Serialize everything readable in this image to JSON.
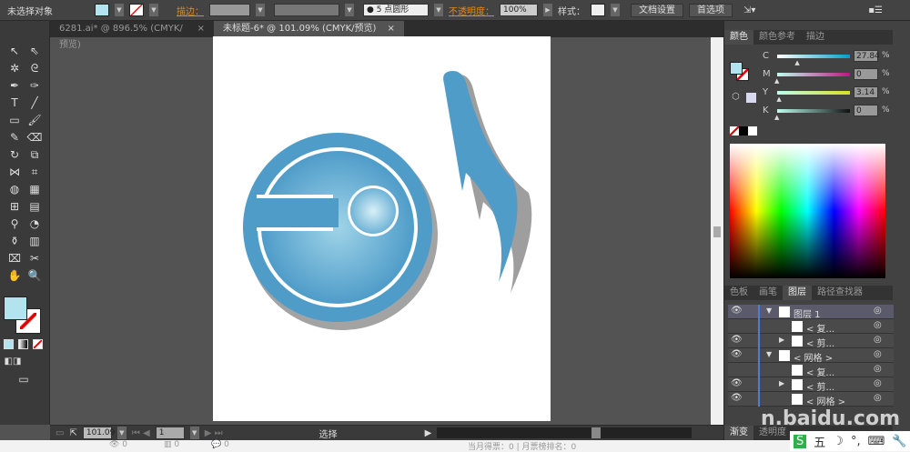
{
  "control_bar": {
    "selection": "未选择对象",
    "stroke_label": "描边：",
    "brush": "5 点圆形",
    "opacity_label": "不透明度：",
    "opacity_value": "100%",
    "style_label": "样式：",
    "doc_setup": "文档设置",
    "preferences": "首选项"
  },
  "tabs": [
    {
      "label": "6281.ai* @ 896.5% (CMYK/预览)",
      "close": "×"
    },
    {
      "label": "未标题-6* @ 101.09% (CMYK/预览)",
      "close": "×"
    }
  ],
  "status": {
    "zoom": "101.09",
    "page": "1",
    "tool": "选择"
  },
  "below": {
    "a": "0",
    "b": "0",
    "c": "0",
    "right": "当月得票：0 | 月票榜排名：0"
  },
  "color_panel": {
    "tabs": [
      "颜色",
      "颜色参考",
      "描边"
    ],
    "channels": [
      {
        "name": "C",
        "value": "27.84",
        "pct": "%",
        "pos": 0.28,
        "grad": "linear-gradient(90deg,#fff,#00a0c6)"
      },
      {
        "name": "M",
        "value": "0",
        "pct": "%",
        "pos": 0,
        "grad": "linear-gradient(90deg,#bfe,#c0157f)"
      },
      {
        "name": "Y",
        "value": "3.14",
        "pct": "%",
        "pos": 0.03,
        "grad": "linear-gradient(90deg,#bfe,#d9e021)"
      },
      {
        "name": "K",
        "value": "0",
        "pct": "%",
        "pos": 0,
        "grad": "linear-gradient(90deg,#bfe,#111)"
      }
    ]
  },
  "layers_panel": {
    "tabs": [
      "色板",
      "画笔",
      "图层",
      "路径查找器"
    ],
    "rows": [
      {
        "label": "图层 1",
        "eye": true,
        "exp": "▼"
      },
      {
        "label": "< 复...",
        "eye": false,
        "exp": ""
      },
      {
        "label": "< 剪...",
        "eye": true,
        "exp": "▶"
      },
      {
        "label": "< 网格 >",
        "eye": true,
        "exp": "▼"
      },
      {
        "label": "< 复...",
        "eye": false,
        "exp": ""
      },
      {
        "label": "< 剪...",
        "eye": true,
        "exp": "▶"
      },
      {
        "label": "< 网格 >",
        "eye": true,
        "exp": ""
      }
    ],
    "bottom_tabs": [
      "渐变",
      "透明度"
    ]
  },
  "watermark": "n.baidu.com",
  "ime": "五",
  "colors": {
    "fill": "#b3e3ee",
    "logo": "#4f9cc9",
    "shadow": "#9e9e9e"
  }
}
